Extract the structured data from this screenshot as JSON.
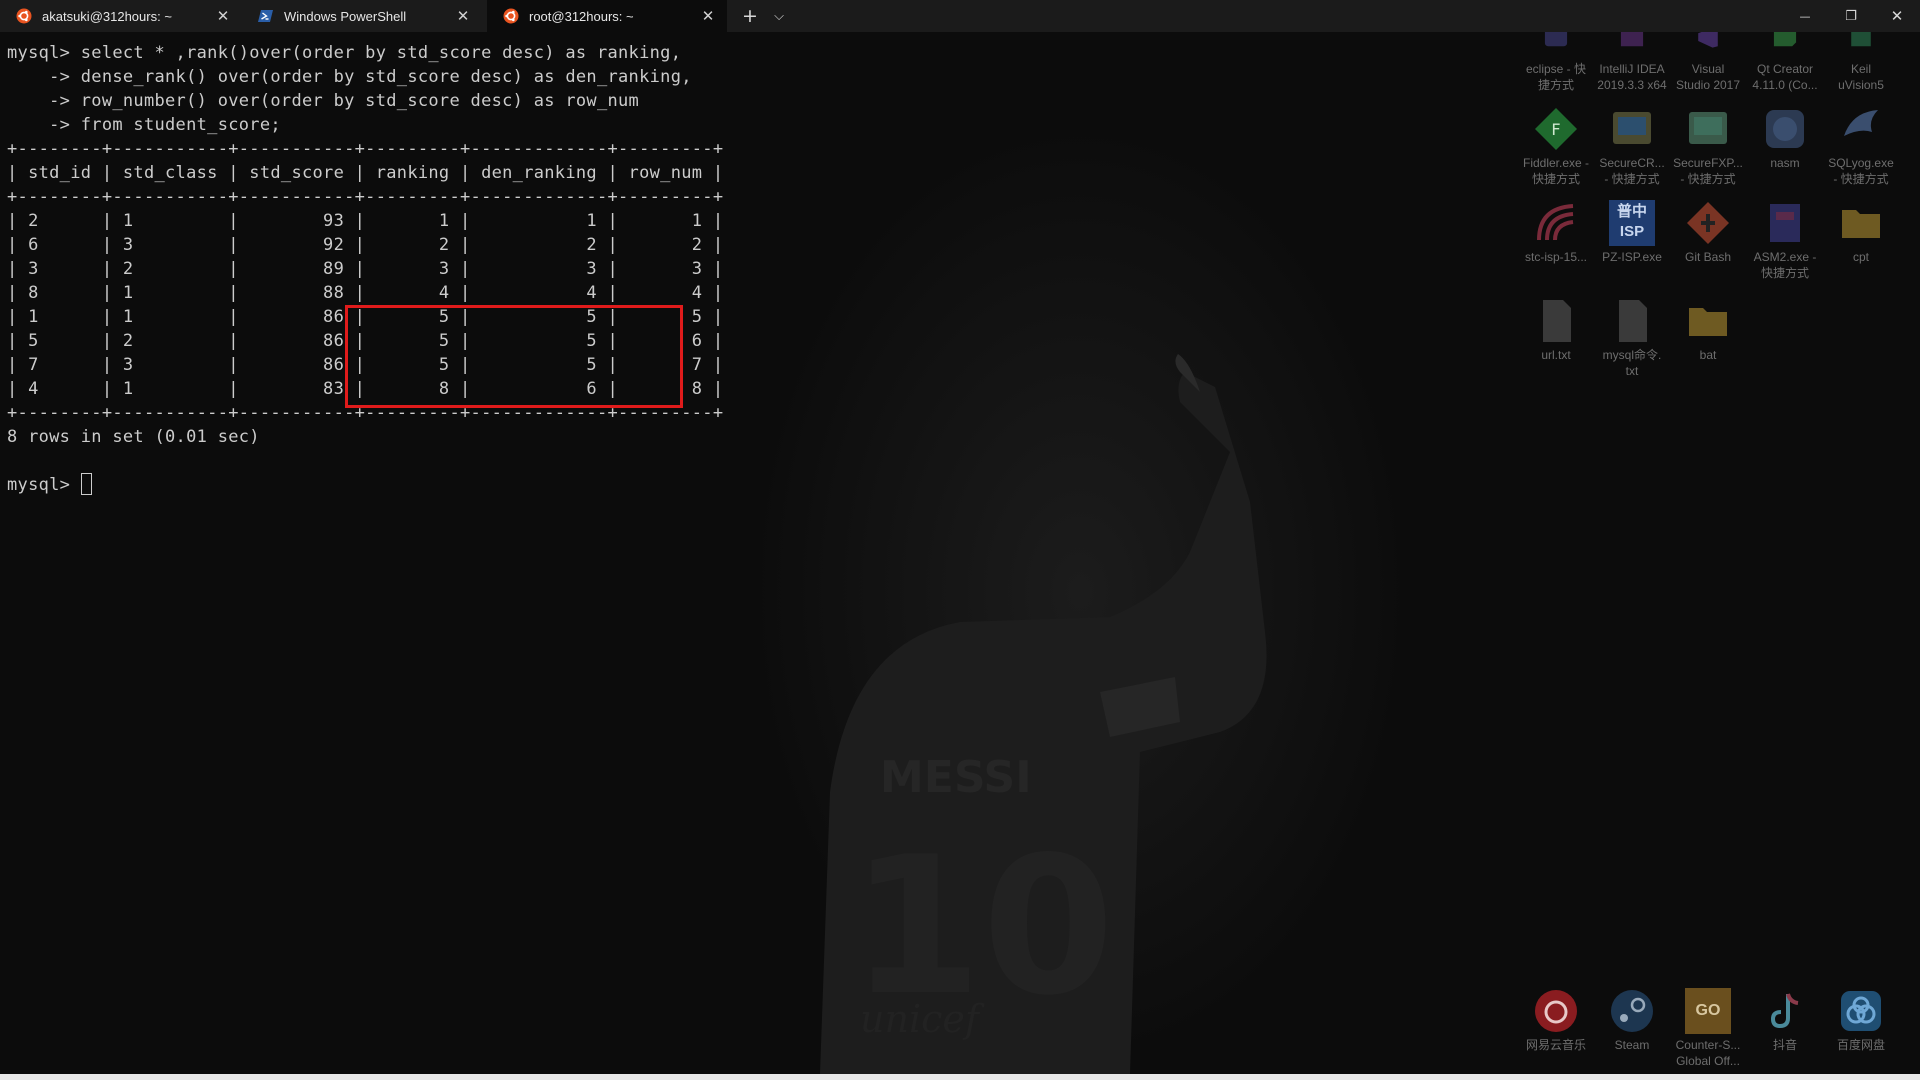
{
  "window": {
    "tabs": [
      {
        "title": "akatsuki@312hours: ~",
        "icon": "ubuntu-icon"
      },
      {
        "title": "Windows PowerShell",
        "icon": "powershell-icon"
      },
      {
        "title": "root@312hours: ~",
        "icon": "ubuntu-icon",
        "active": true
      }
    ],
    "close_glyph": "✕",
    "new_tab_glyph": "+",
    "dropdown_glyph": "⌵",
    "minimize_glyph": "—",
    "maximize_glyph": "❐",
    "close_window_glyph": "✕"
  },
  "terminal": {
    "lines": [
      "mysql> select * ,rank()over(order by std_score desc) as ranking,",
      "    -> dense_rank() over(order by std_score desc) as den_ranking,",
      "    -> row_number() over(order by std_score desc) as row_num",
      "    -> from student_score;",
      "+--------+-----------+-----------+---------+-------------+---------+",
      "| std_id | std_class | std_score | ranking | den_ranking | row_num |",
      "+--------+-----------+-----------+---------+-------------+---------+",
      "| 2      | 1         |        93 |       1 |           1 |       1 |",
      "| 6      | 3         |        92 |       2 |           2 |       2 |",
      "| 3      | 2         |        89 |       3 |           3 |       3 |",
      "| 8      | 1         |        88 |       4 |           4 |       4 |",
      "| 1      | 1         |        86 |       5 |           5 |       5 |",
      "| 5      | 2         |        86 |       5 |           5 |       6 |",
      "| 7      | 3         |        86 |       5 |           5 |       7 |",
      "| 4      | 1         |        83 |       8 |           6 |       8 |",
      "+--------+-----------+-----------+---------+-------------+---------+",
      "8 rows in set (0.01 sec)",
      "",
      "mysql> "
    ],
    "colors": {
      "background": "#0c0c0c",
      "foreground": "#cccccc",
      "highlight": "#e01b1b"
    }
  },
  "desktop_icons": [
    {
      "label": "eclipse - 快\n捷方式",
      "icon": "eclipse-icon",
      "color": "#3b3a6e"
    },
    {
      "label": "IntelliJ IDEA\n2019.3.3 x64",
      "icon": "intellij-icon",
      "color": "#5a2c6e"
    },
    {
      "label": "Visual\nStudio 2017",
      "icon": "visual-studio-icon",
      "color": "#5c3b8a"
    },
    {
      "label": "Qt Creator\n4.11.0 (Co...",
      "icon": "qt-creator-icon",
      "color": "#2f7a3a"
    },
    {
      "label": "Keil\nuVision5",
      "icon": "keil-icon",
      "color": "#2c6e4a"
    },
    {
      "label": "Fiddler.exe -\n快捷方式",
      "icon": "fiddler-icon",
      "color": "#2f8a3f"
    },
    {
      "label": "SecureCR...\n- 快捷方式",
      "icon": "securecrt-icon",
      "color": "#6a6a3a"
    },
    {
      "label": "SecureFXP...\n- 快捷方式",
      "icon": "securefx-icon",
      "color": "#4a7a6a"
    },
    {
      "label": "nasm",
      "icon": "nasm-icon",
      "color": "#3a4a6e"
    },
    {
      "label": "SQLyog.exe\n- 快捷方式",
      "icon": "sqlyog-icon",
      "color": "#3a4e6e"
    },
    {
      "label": "stc-isp-15...",
      "icon": "stc-isp-icon",
      "color": "#7a2a3a"
    },
    {
      "label": "PZ-ISP.exe",
      "icon": "pz-isp-icon",
      "color": "#2c4f8a",
      "glyph_text": "普中\nISP"
    },
    {
      "label": "Git Bash",
      "icon": "git-bash-icon",
      "color": "#8a3a2a"
    },
    {
      "label": "ASM2.exe -\n快捷方式",
      "icon": "asm2-icon",
      "color": "#3a3a7a"
    },
    {
      "label": "cpt",
      "icon": "folder-icon",
      "color": "#8a7330"
    },
    {
      "label": "url.txt",
      "icon": "text-file-icon",
      "color": "#8a8a8a"
    },
    {
      "label": "mysql命令.\ntxt",
      "icon": "text-file-icon",
      "color": "#8a8a8a"
    },
    {
      "label": "bat",
      "icon": "folder-icon",
      "color": "#8a7330"
    },
    {
      "label": "网易云音乐",
      "icon": "netease-music-icon",
      "color": "#b8262a"
    },
    {
      "label": "Steam",
      "icon": "steam-icon",
      "color": "#2b4f6e"
    },
    {
      "label": "Counter-S...\nGlobal Off...",
      "icon": "csgo-icon",
      "color": "#8a6a2a",
      "glyph_text": "GO"
    },
    {
      "label": "抖音",
      "icon": "douyin-icon",
      "color": "#1a1a1a"
    },
    {
      "label": "百度网盘",
      "icon": "baidu-netdisk-icon",
      "color": "#2c6ea0"
    }
  ],
  "wallpaper": {
    "jersey_name": "MESSI",
    "jersey_number": "10",
    "sponsor": "unicef"
  }
}
